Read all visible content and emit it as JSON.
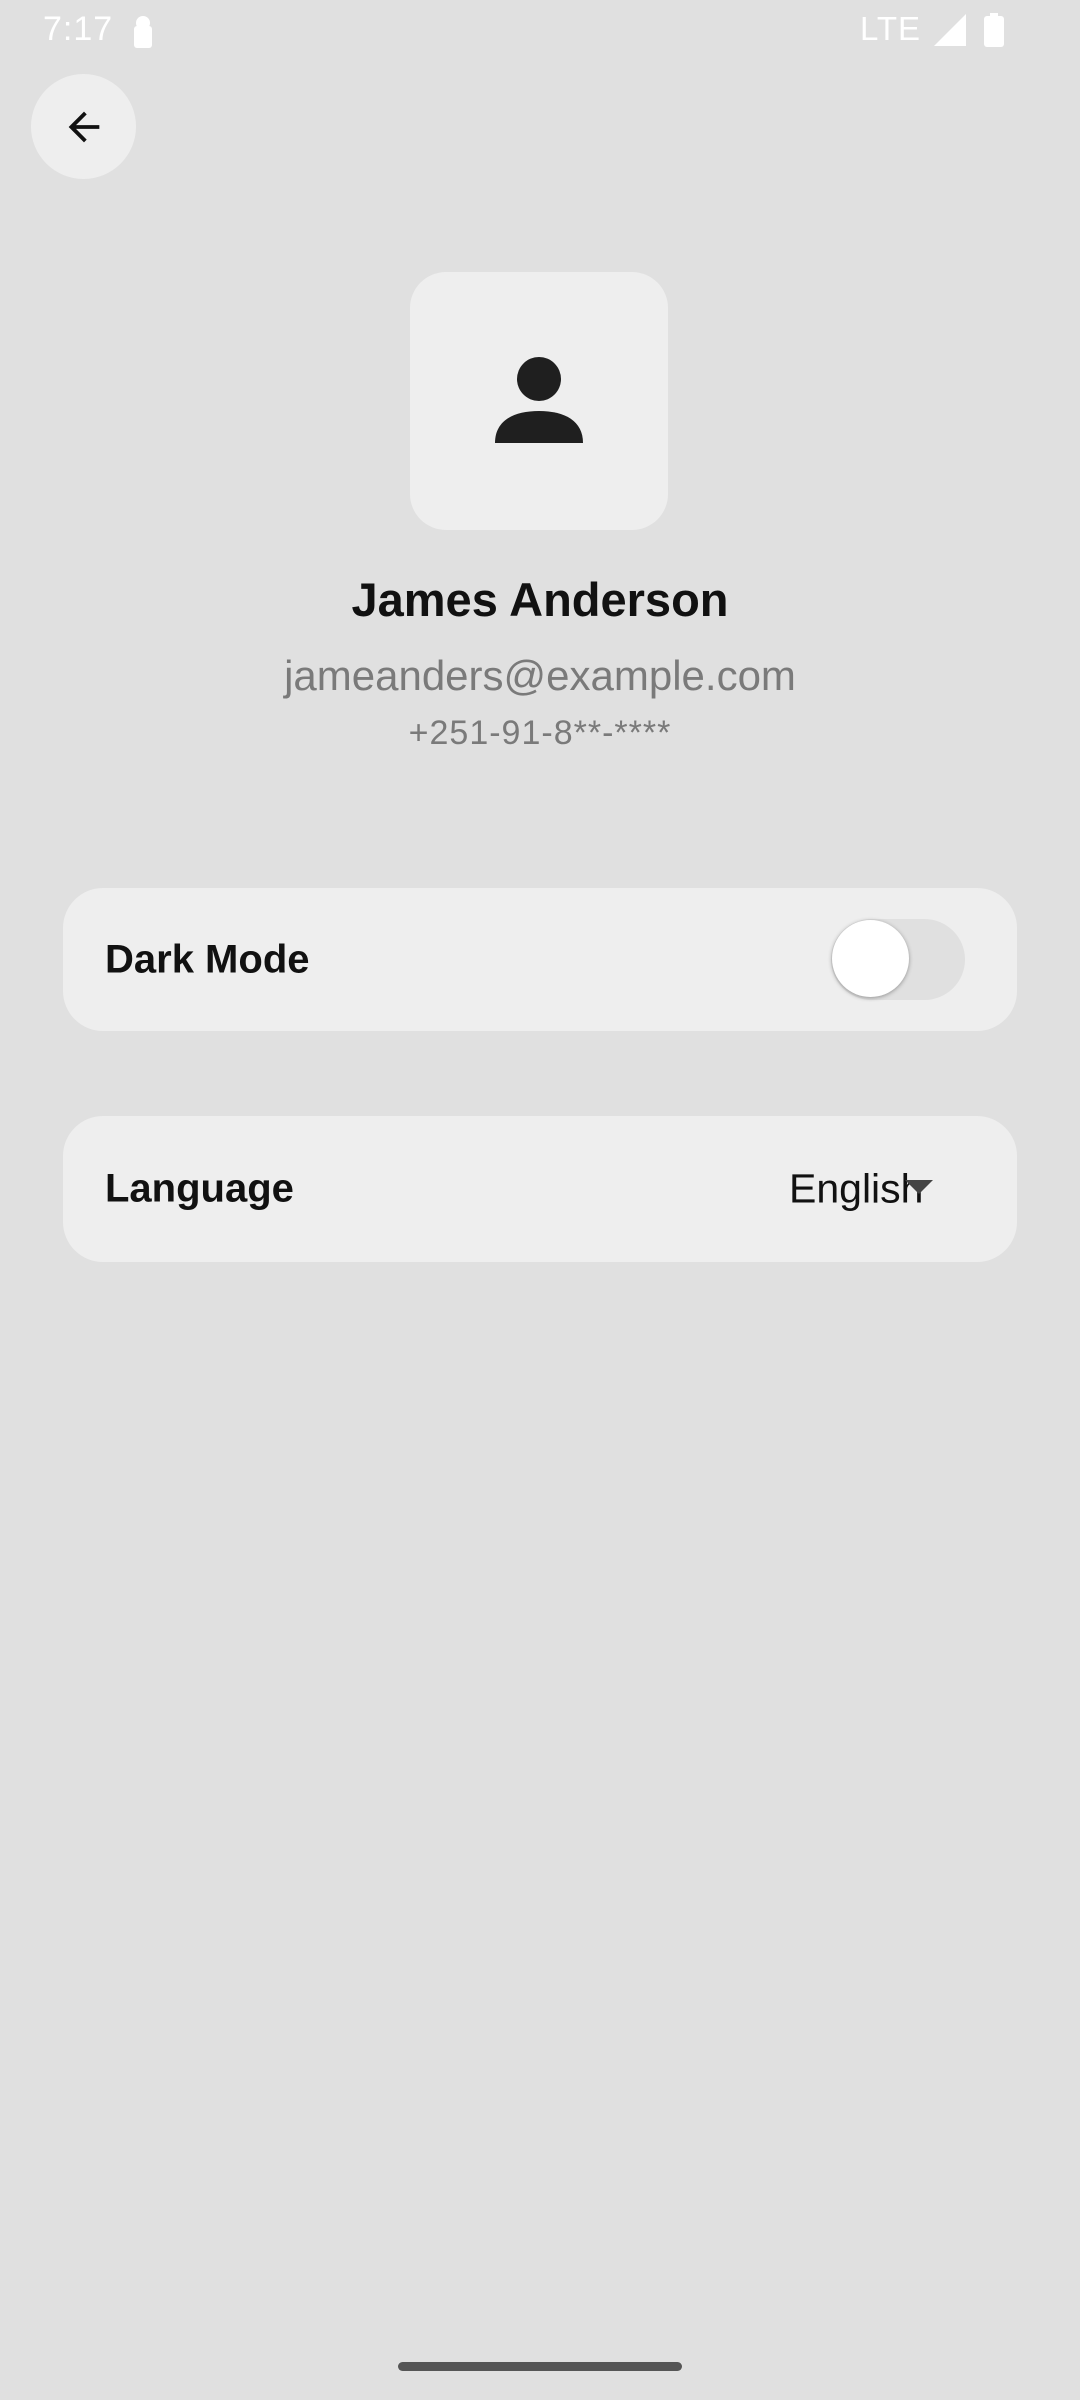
{
  "status_bar": {
    "time": "7:17",
    "network": "LTE",
    "icons": [
      "lock-icon",
      "signal-icon",
      "battery-icon"
    ]
  },
  "header": {
    "back_icon": "arrow-back-icon"
  },
  "profile": {
    "avatar_icon": "person-icon",
    "name": "James Anderson",
    "email": "jameanders@example.com",
    "phone": "+251-91-8**-****"
  },
  "settings": {
    "dark_mode": {
      "label": "Dark Mode",
      "enabled": false
    },
    "language": {
      "label": "Language",
      "selected": "English",
      "icon": "dropdown-arrow-icon"
    }
  },
  "colors": {
    "background": "#e0e0e0",
    "card": "#eeeeee",
    "secondary_text": "#7a7a7a"
  }
}
